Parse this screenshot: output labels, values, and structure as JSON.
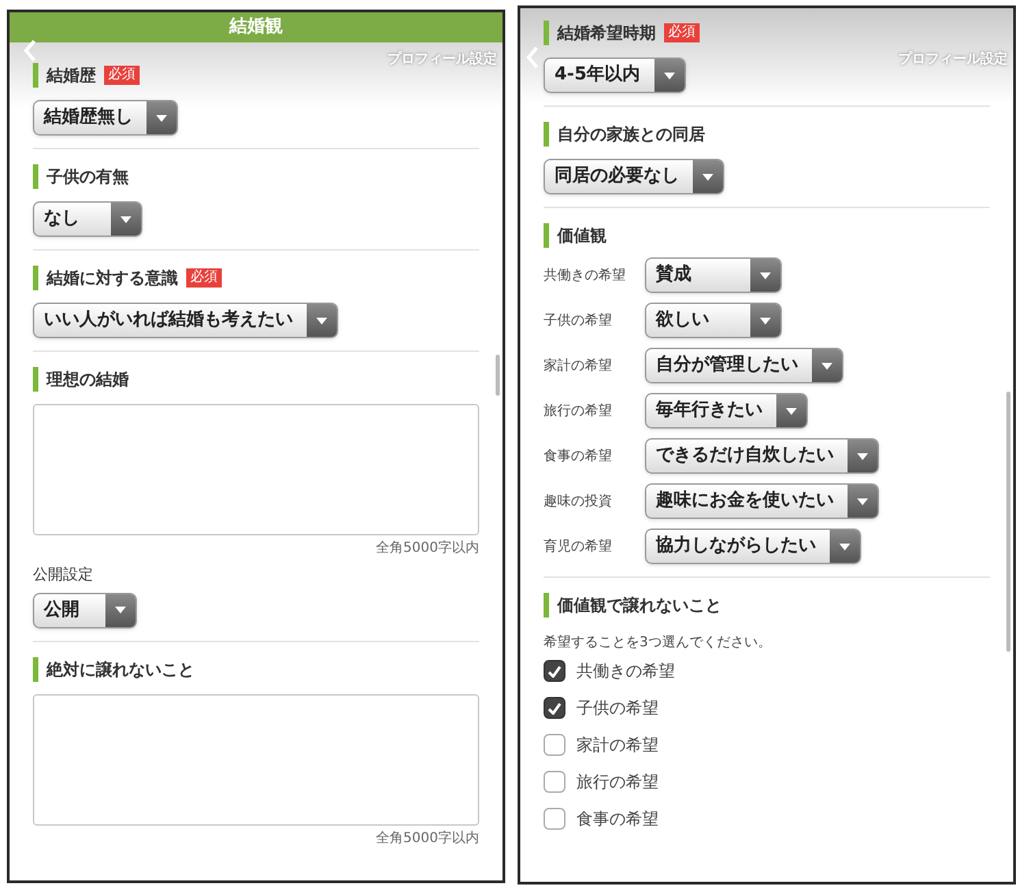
{
  "screens": [
    {
      "header": {
        "title": "結婚観"
      },
      "overlay_title": "プロフィール設定",
      "sections": [
        {
          "kind": "select",
          "label": "結婚歴",
          "badge": "必須",
          "value": "結婚歴無し"
        },
        {
          "kind": "select",
          "label": "子供の有無",
          "value": "なし"
        },
        {
          "kind": "select",
          "label": "結婚に対する意識",
          "badge": "必須",
          "value": "いい人がいれば結婚も考えたい"
        },
        {
          "kind": "textarea",
          "label": "理想の結婚",
          "counter": "全角5000字以内",
          "visibility": {
            "label": "公開設定",
            "value": "公開"
          }
        },
        {
          "kind": "textarea",
          "label": "絶対に譲れないこと",
          "counter": "全角5000字以内"
        }
      ]
    },
    {
      "overlay_title": "プロフィール設定",
      "sections": [
        {
          "kind": "select",
          "label": "結婚希望時期",
          "badge": "必須",
          "value": "4-5年以内"
        },
        {
          "kind": "select",
          "label": "自分の家族との同居",
          "value": "同居の必要なし"
        },
        {
          "kind": "pairs",
          "label": "価値観",
          "rows": [
            {
              "label": "共働きの希望",
              "value": "賛成"
            },
            {
              "label": "子供の希望",
              "value": "欲しい"
            },
            {
              "label": "家計の希望",
              "value": "自分が管理したい"
            },
            {
              "label": "旅行の希望",
              "value": "毎年行きたい"
            },
            {
              "label": "食事の希望",
              "value": "できるだけ自炊したい"
            },
            {
              "label": "趣味の投資",
              "value": "趣味にお金を使いたい"
            },
            {
              "label": "育児の希望",
              "value": "協力しながらしたい"
            }
          ]
        },
        {
          "kind": "checklist",
          "label": "価値観で譲れないこと",
          "note": "希望することを3つ選んでください。",
          "items": [
            {
              "label": "共働きの希望",
              "checked": true
            },
            {
              "label": "子供の希望",
              "checked": true
            },
            {
              "label": "家計の希望",
              "checked": false
            },
            {
              "label": "旅行の希望",
              "checked": false
            },
            {
              "label": "食事の希望",
              "checked": false
            }
          ]
        }
      ]
    }
  ]
}
